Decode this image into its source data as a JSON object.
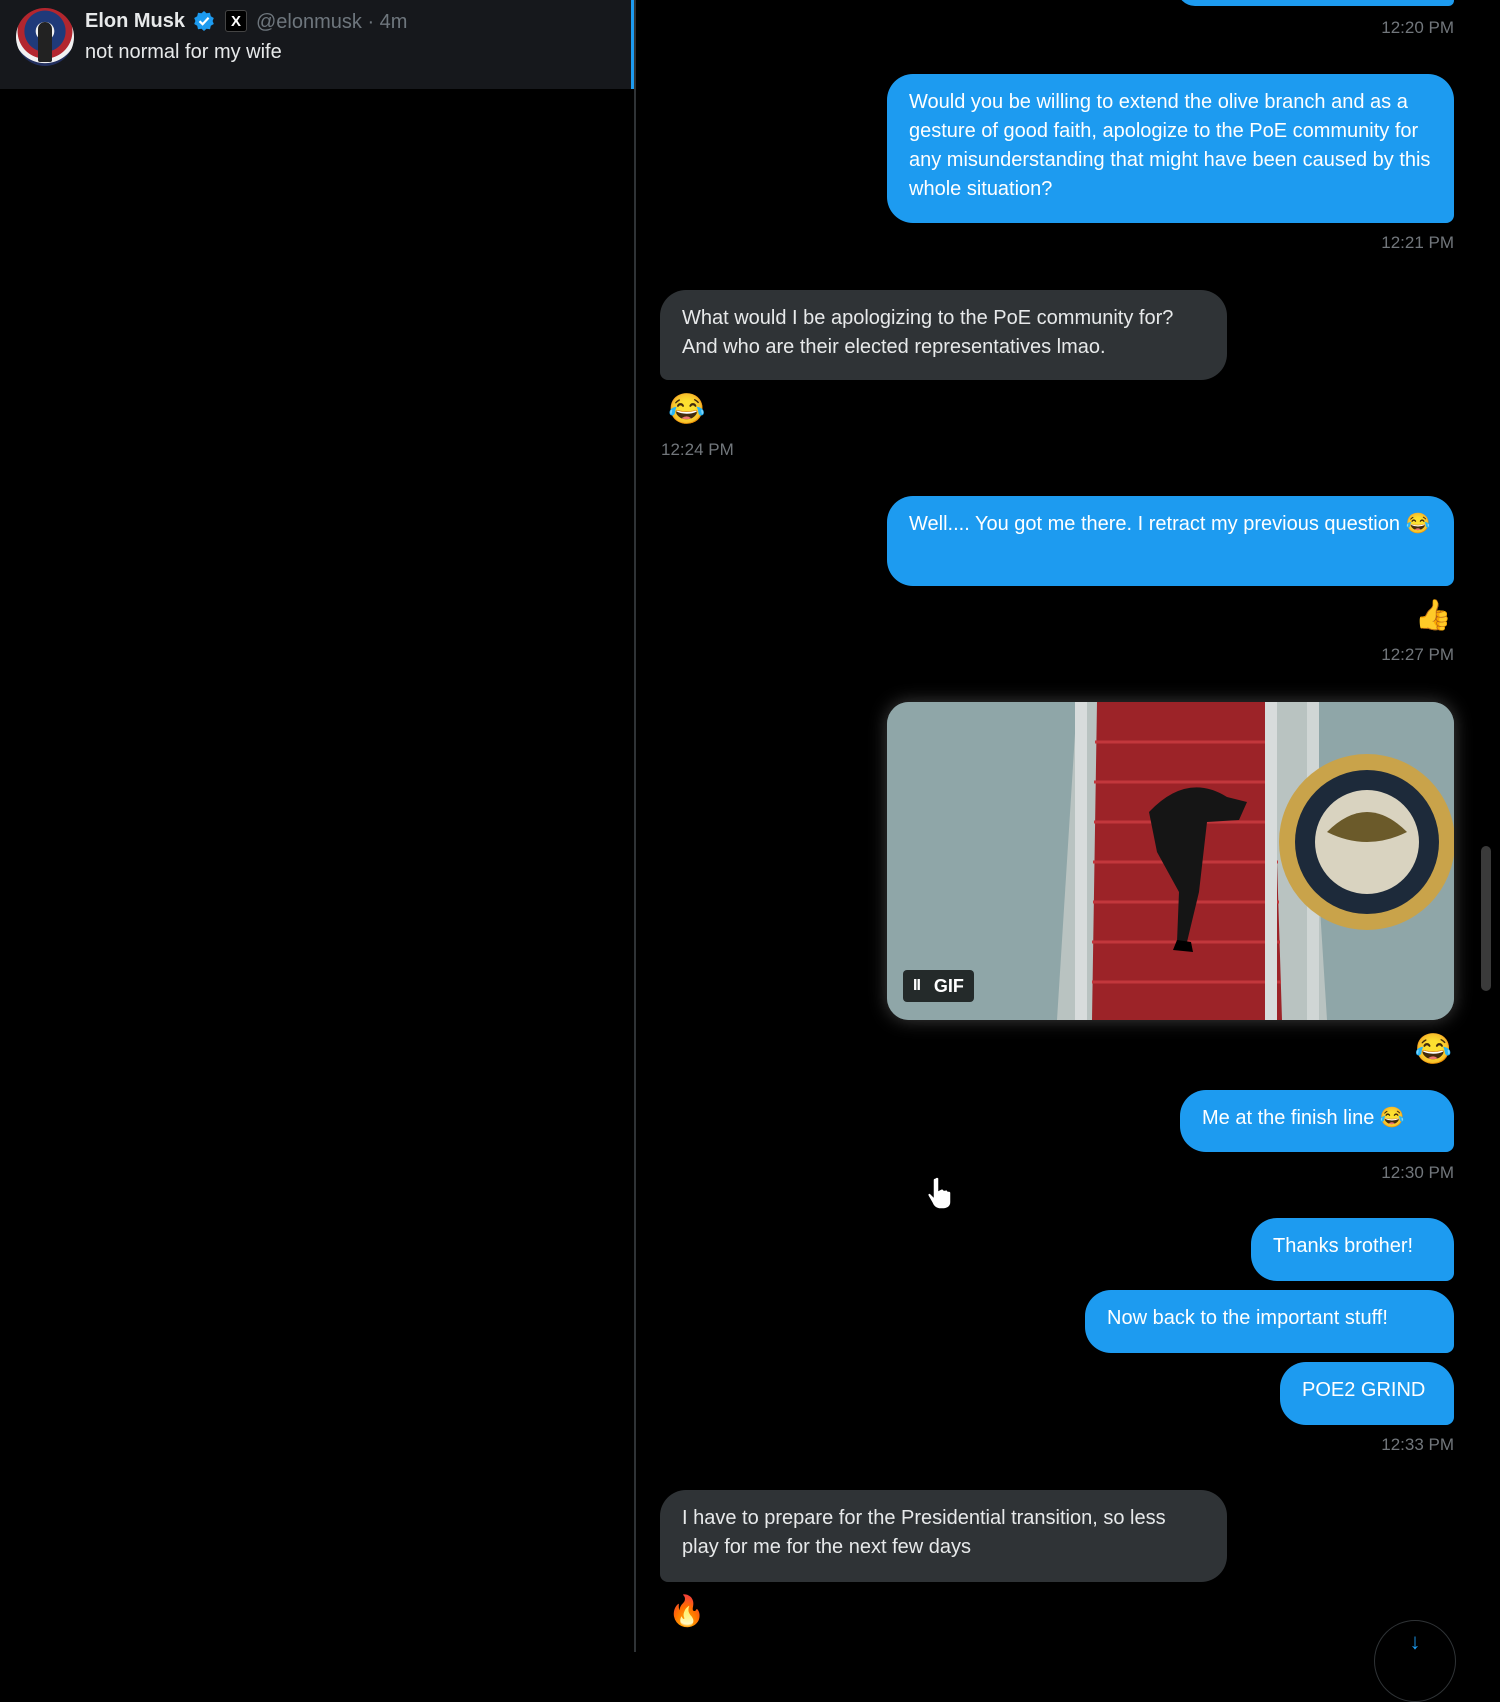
{
  "conversation": {
    "sender_name": "Elon Musk",
    "handle_time": "@elonmusk · 4m",
    "preview_text": "not normal for my wife",
    "x_badge": "X",
    "verified_icon": "verified-badge-icon",
    "accent": "#1d9bf0"
  },
  "messages": [
    {
      "from": "me",
      "text": "Would you be willing to extend the olive branch and as a gesture of good faith, apologize to the PoE community for any misunderstanding that might have been caused by this whole situation?",
      "time": "12:21 PM"
    },
    {
      "from": "them",
      "text": "What would I be apologizing to the PoE community for? And who are their elected representatives lmao.",
      "reaction": "😂",
      "time": "12:24 PM"
    },
    {
      "from": "me",
      "text": "Well.... You got me there. I retract my previous question 😂",
      "reaction": "👍",
      "time": "12:27 PM"
    },
    {
      "from": "me",
      "type": "gif",
      "gif_label": "GIF",
      "pause_label": "II",
      "reaction": "😂"
    },
    {
      "from": "me",
      "text": "Me at the finish line 😂",
      "time": "12:30 PM"
    },
    {
      "from": "me",
      "text": "Thanks brother!"
    },
    {
      "from": "me",
      "text": "Now back to the important stuff!"
    },
    {
      "from": "me",
      "text": "POE2 GRIND",
      "time": "12:33 PM"
    },
    {
      "from": "them",
      "text": "I have to prepare for the Presidential transition, so less play for me for the next few days",
      "reaction": "🔥"
    }
  ],
  "top_time": "12:20 PM",
  "scroll_button_icon": "arrow-down-icon",
  "scroll_arrow": "↓"
}
